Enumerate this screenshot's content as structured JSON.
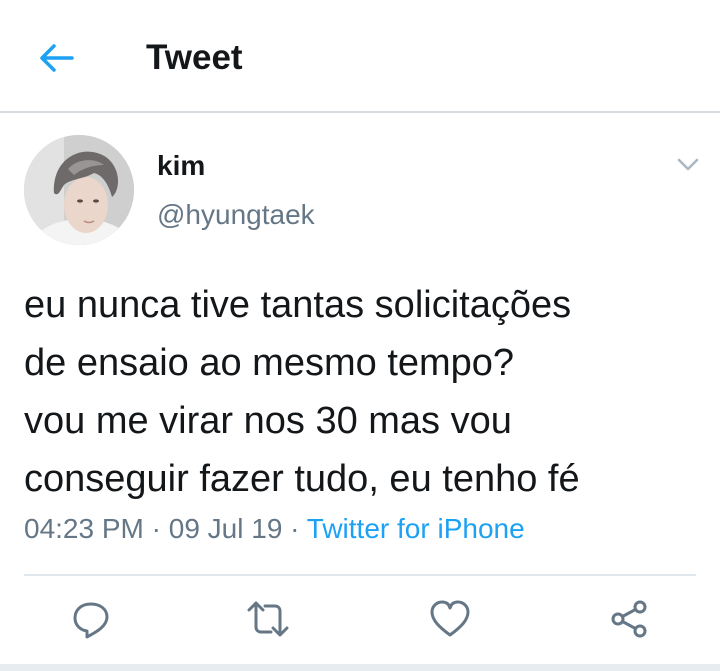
{
  "header": {
    "title": "Tweet",
    "back_icon": "arrow-left-icon",
    "accent_color": "#1da1f2"
  },
  "author": {
    "display_name": "kim",
    "handle": "@hyungtaek",
    "avatar_icon": "avatar-photo"
  },
  "tweet": {
    "lines": [
      "eu nunca tive tantas solicitações",
      "de ensaio ao mesmo tempo?",
      "vou me virar nos 30 mas vou",
      "conseguir fazer tudo, eu tenho fé"
    ]
  },
  "meta": {
    "time": "04:23 PM",
    "separator": " · ",
    "date": "09 Jul 19",
    "source": "Twitter for iPhone"
  },
  "actions": [
    {
      "name": "reply",
      "icon": "reply-icon"
    },
    {
      "name": "retweet",
      "icon": "retweet-icon"
    },
    {
      "name": "like",
      "icon": "heart-icon"
    },
    {
      "name": "share",
      "icon": "share-icon"
    }
  ]
}
